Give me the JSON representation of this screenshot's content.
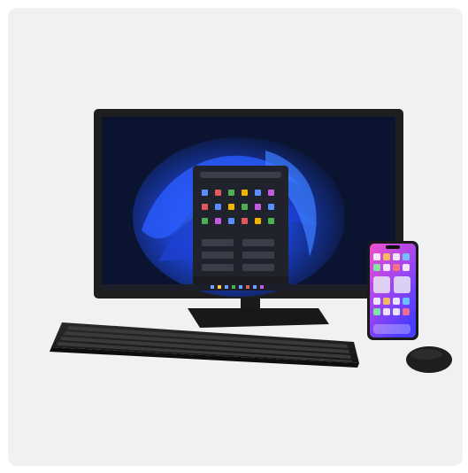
{
  "scene": {
    "description_items": [
      "monitor",
      "keyboard",
      "mouse",
      "smartphone"
    ],
    "colors": {
      "background": "#f1f1f1",
      "device_body": "#1e1e20",
      "wallpaper_dark": "#0a1430",
      "wallpaper_bloom": "#2f6bff",
      "start_menu": "#20232b",
      "phone_gradient_top": "#e64fd8",
      "phone_gradient_bottom": "#4a3cff"
    },
    "icons": [
      "windows-start-menu-icon",
      "taskbar-icon",
      "phone-app-icon"
    ]
  }
}
